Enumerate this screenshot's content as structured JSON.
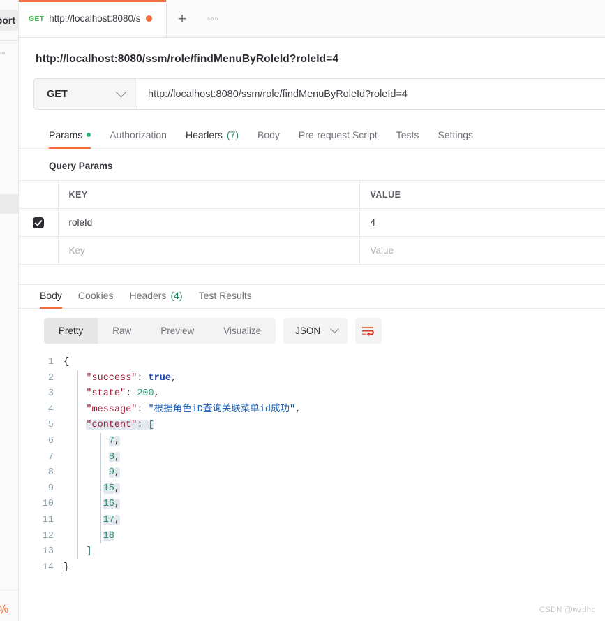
{
  "sidebar": {
    "import_label": "Import",
    "more_icon": "ellipsis-icon",
    "bottom_glyph": "%"
  },
  "tabstrip": {
    "tabs": [
      {
        "method": "GET",
        "title": "http://localhost:8080/s",
        "unsaved": true
      }
    ],
    "new_tab_label": "+",
    "more_label": "◦◦◦"
  },
  "request": {
    "title": "http://localhost:8080/ssm/role/findMenuByRoleId?roleId=4",
    "method": "GET",
    "url": "http://localhost:8080/ssm/role/findMenuByRoleId?roleId=4",
    "tabs": [
      {
        "label": "Params",
        "active": true,
        "dot": true
      },
      {
        "label": "Authorization",
        "active": false
      },
      {
        "label": "Headers",
        "count": "(7)",
        "active": false,
        "dark": true
      },
      {
        "label": "Body",
        "active": false
      },
      {
        "label": "Pre-request Script",
        "active": false
      },
      {
        "label": "Tests",
        "active": false
      },
      {
        "label": "Settings",
        "active": false
      }
    ],
    "query_params_label": "Query Params",
    "table": {
      "columns": [
        "KEY",
        "VALUE"
      ],
      "rows": [
        {
          "checked": true,
          "key": "roleId",
          "value": "4"
        },
        {
          "checked": false,
          "key_placeholder": "Key",
          "value_placeholder": "Value"
        }
      ]
    }
  },
  "response": {
    "tabs": [
      {
        "label": "Body",
        "active": true
      },
      {
        "label": "Cookies",
        "active": false
      },
      {
        "label": "Headers",
        "count": "(4)",
        "active": false
      },
      {
        "label": "Test Results",
        "active": false
      }
    ],
    "view_modes": [
      {
        "label": "Pretty",
        "active": true
      },
      {
        "label": "Raw",
        "active": false
      },
      {
        "label": "Preview",
        "active": false
      },
      {
        "label": "Visualize",
        "active": false
      }
    ],
    "format": "JSON",
    "wrap_icon": "wrap-lines-icon",
    "body_lines": [
      {
        "n": "1",
        "segments": [
          {
            "t": "{",
            "c": "tok-pun"
          }
        ]
      },
      {
        "n": "2",
        "segments": [
          {
            "t": "    ",
            "c": "tok-pun"
          },
          {
            "t": "\"success\"",
            "c": "tok-key"
          },
          {
            "t": ": ",
            "c": "tok-pun"
          },
          {
            "t": "true",
            "c": "tok-bool"
          },
          {
            "t": ",",
            "c": "tok-pun"
          }
        ]
      },
      {
        "n": "3",
        "segments": [
          {
            "t": "    ",
            "c": "tok-pun"
          },
          {
            "t": "\"state\"",
            "c": "tok-key"
          },
          {
            "t": ": ",
            "c": "tok-pun"
          },
          {
            "t": "200",
            "c": "tok-num"
          },
          {
            "t": ",",
            "c": "tok-pun"
          }
        ]
      },
      {
        "n": "4",
        "segments": [
          {
            "t": "    ",
            "c": "tok-pun"
          },
          {
            "t": "\"message\"",
            "c": "tok-key"
          },
          {
            "t": ": ",
            "c": "tok-pun"
          },
          {
            "t": "\"根据角色iD查询关联菜单id成功\"",
            "c": "tok-str"
          },
          {
            "t": ",",
            "c": "tok-pun"
          }
        ]
      },
      {
        "n": "5",
        "segments": [
          {
            "t": "    ",
            "c": "tok-pun"
          },
          {
            "t": "\"content\"",
            "c": "tok-key",
            "hl": true
          },
          {
            "t": ": ",
            "c": "tok-pun",
            "hl": true
          },
          {
            "t": "[",
            "c": "tok-brk",
            "hl": true
          }
        ]
      },
      {
        "n": "6",
        "segments": [
          {
            "t": "        ",
            "c": "tok-pun"
          },
          {
            "t": "7",
            "c": "tok-num",
            "hl": true
          },
          {
            "t": ",",
            "c": "tok-pun",
            "hl": true
          }
        ]
      },
      {
        "n": "7",
        "segments": [
          {
            "t": "        ",
            "c": "tok-pun"
          },
          {
            "t": "8",
            "c": "tok-num",
            "hl": true
          },
          {
            "t": ",",
            "c": "tok-pun",
            "hl": true
          }
        ]
      },
      {
        "n": "8",
        "segments": [
          {
            "t": "        ",
            "c": "tok-pun"
          },
          {
            "t": "9",
            "c": "tok-num",
            "hl": true
          },
          {
            "t": ",",
            "c": "tok-pun",
            "hl": true
          }
        ]
      },
      {
        "n": "9",
        "segments": [
          {
            "t": "       ",
            "c": "tok-pun"
          },
          {
            "t": "15",
            "c": "tok-num",
            "hl": true
          },
          {
            "t": ",",
            "c": "tok-pun",
            "hl": true
          }
        ]
      },
      {
        "n": "10",
        "segments": [
          {
            "t": "       ",
            "c": "tok-pun"
          },
          {
            "t": "16",
            "c": "tok-num",
            "hl": true
          },
          {
            "t": ",",
            "c": "tok-pun",
            "hl": true
          }
        ]
      },
      {
        "n": "11",
        "segments": [
          {
            "t": "       ",
            "c": "tok-pun"
          },
          {
            "t": "17",
            "c": "tok-num",
            "hl": true
          },
          {
            "t": ",",
            "c": "tok-pun",
            "hl": true
          }
        ]
      },
      {
        "n": "12",
        "segments": [
          {
            "t": "       ",
            "c": "tok-pun"
          },
          {
            "t": "18",
            "c": "tok-num",
            "hl": true
          }
        ]
      },
      {
        "n": "13",
        "segments": [
          {
            "t": "    ",
            "c": "tok-pun"
          },
          {
            "t": "]",
            "c": "tok-brk"
          }
        ]
      },
      {
        "n": "14",
        "segments": [
          {
            "t": "}",
            "c": "tok-pun"
          }
        ]
      }
    ],
    "parsed_json": {
      "success": true,
      "state": 200,
      "message": "根据角色iD查询关联菜单id成功",
      "content": [
        7,
        8,
        9,
        15,
        16,
        17,
        18
      ]
    }
  },
  "watermark": "CSDN @wzdhc",
  "colors": {
    "accent": "#f26b3a",
    "method_get": "#3fb950",
    "count_green": "#2b8a6a",
    "highlight": "#e3e8ef"
  }
}
